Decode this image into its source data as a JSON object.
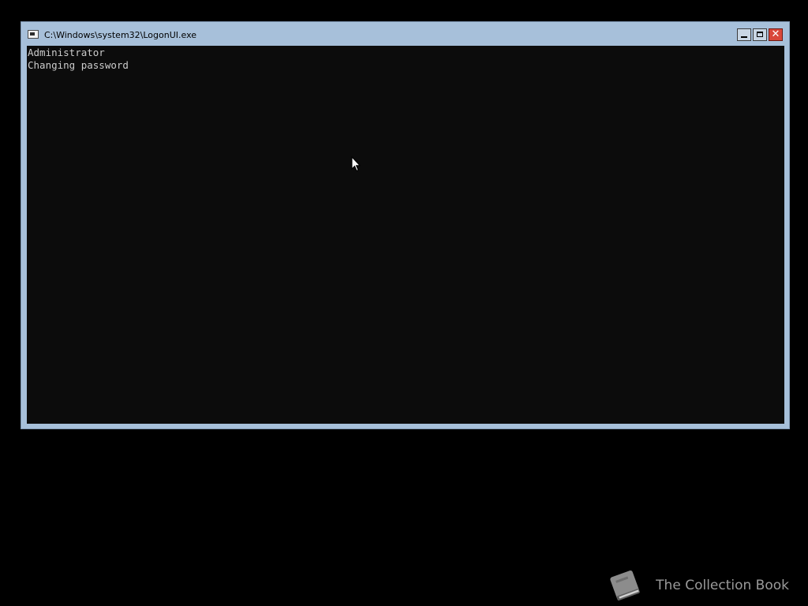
{
  "window": {
    "title": "C:\\Windows\\system32\\LogonUI.exe",
    "icon": "console-app-icon",
    "buttons": {
      "minimize": "minimize-icon",
      "maximize": "maximize-icon",
      "close": "close-icon",
      "close_glyph": "✕"
    }
  },
  "console": {
    "lines": [
      "Administrator",
      "Changing password"
    ],
    "background": "#0c0c0c",
    "foreground": "#cccccc"
  },
  "titlebar_color": "#a7c0da",
  "watermark": {
    "icon": "book-icon",
    "text": "The Collection Book"
  }
}
